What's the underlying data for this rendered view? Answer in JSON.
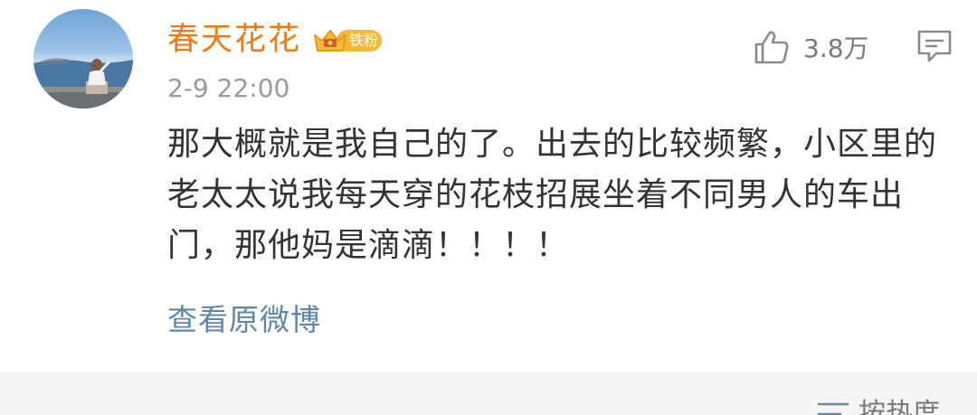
{
  "post": {
    "username": "春天花花",
    "badge": "铁粉",
    "timestamp": "2-9 22:00",
    "likes": "3.8万",
    "content": "那大概就是我自己的了。出去的比较频繁，小区里的老太太说我每天穿的花枝招展坐着不同男人的车出门，那他妈是滴滴！！！！",
    "view_original": "查看原微博"
  },
  "footer": {
    "sort_label": "按热度"
  },
  "colors": {
    "username": "#f07a10",
    "link": "#5f87ab",
    "badge": "#f5b93a"
  },
  "icons": {
    "like": "thumbs-up-icon",
    "comment": "comment-icon",
    "sort": "sort-icon",
    "badge": "crown-icon"
  }
}
